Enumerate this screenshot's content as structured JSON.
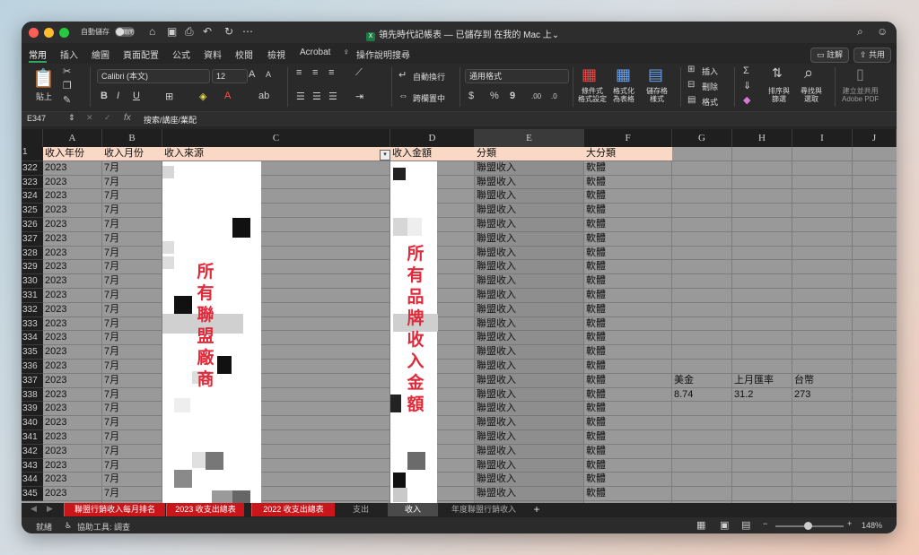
{
  "titlebar": {
    "autosave": "自動儲存",
    "toggle": "關閉",
    "title": "領先時代記帳表 — 已儲存到 在我的 Mac 上",
    "title_arrow": "⌄"
  },
  "menu_tabs": [
    "常用",
    "插入",
    "繪圖",
    "頁面配置",
    "公式",
    "資料",
    "校閱",
    "檢視",
    "Acrobat"
  ],
  "help": "操作說明搜尋",
  "comments_btn": "註解",
  "share_btn": "共用",
  "ribbon": {
    "paste": "貼上",
    "font_name": "Calibri (本文)",
    "font_size": "12",
    "bold": "B",
    "italic": "I",
    "underline": "U",
    "wrap": "自動換行",
    "merge": "跨欄置中",
    "number_format": "通用格式",
    "currency": "$",
    "percent": "%",
    "comma": "9",
    "cond_format": "條件式\n格式設定",
    "format_table": "格式化\n為表格",
    "cell_style": "儲存格\n樣式",
    "insert": "插入",
    "delete": "刪除",
    "format": "格式",
    "sort": "排序與\n篩選",
    "find": "尋找與\n選取",
    "pdf": "建立並共用\nAdobe PDF"
  },
  "formula_bar": {
    "name_box": "E347",
    "fx": "fx",
    "content": "搜索/講座/業配"
  },
  "columns": [
    "A",
    "B",
    "C",
    "D",
    "E",
    "F",
    "G",
    "H",
    "I",
    "J"
  ],
  "header_row": {
    "row": "1",
    "a": "收入年份",
    "b": "收入月份",
    "c": "收入來源",
    "d": "收入金額",
    "e": "分類",
    "f": "大分類"
  },
  "rows": [
    {
      "n": "322",
      "a": "2023",
      "b": "7月",
      "e": "聯盟收入",
      "f": "軟體"
    },
    {
      "n": "323",
      "a": "2023",
      "b": "7月",
      "e": "聯盟收入",
      "f": "軟體"
    },
    {
      "n": "324",
      "a": "2023",
      "b": "7月",
      "e": "聯盟收入",
      "f": "軟體"
    },
    {
      "n": "325",
      "a": "2023",
      "b": "7月",
      "e": "聯盟收入",
      "f": "軟體"
    },
    {
      "n": "326",
      "a": "2023",
      "b": "7月",
      "e": "聯盟收入",
      "f": "軟體"
    },
    {
      "n": "327",
      "a": "2023",
      "b": "7月",
      "e": "聯盟收入",
      "f": "軟體"
    },
    {
      "n": "328",
      "a": "2023",
      "b": "7月",
      "e": "聯盟收入",
      "f": "軟體"
    },
    {
      "n": "329",
      "a": "2023",
      "b": "7月",
      "e": "聯盟收入",
      "f": "軟體"
    },
    {
      "n": "330",
      "a": "2023",
      "b": "7月",
      "e": "聯盟收入",
      "f": "軟體"
    },
    {
      "n": "331",
      "a": "2023",
      "b": "7月",
      "e": "聯盟收入",
      "f": "軟體"
    },
    {
      "n": "332",
      "a": "2023",
      "b": "7月",
      "e": "聯盟收入",
      "f": "軟體"
    },
    {
      "n": "333",
      "a": "2023",
      "b": "7月",
      "e": "聯盟收入",
      "f": "軟體"
    },
    {
      "n": "334",
      "a": "2023",
      "b": "7月",
      "e": "聯盟收入",
      "f": "軟體"
    },
    {
      "n": "335",
      "a": "2023",
      "b": "7月",
      "e": "聯盟收入",
      "f": "軟體"
    },
    {
      "n": "336",
      "a": "2023",
      "b": "7月",
      "e": "聯盟收入",
      "f": "軟體"
    },
    {
      "n": "337",
      "a": "2023",
      "b": "7月",
      "e": "聯盟收入",
      "f": "軟體",
      "g": "美金",
      "h": "上月匯率",
      "i": "台幣"
    },
    {
      "n": "338",
      "a": "2023",
      "b": "7月",
      "e": "聯盟收入",
      "f": "軟體",
      "g": "8.74",
      "h": "31.2",
      "i": "273"
    },
    {
      "n": "339",
      "a": "2023",
      "b": "7月",
      "e": "聯盟收入",
      "f": "軟體"
    },
    {
      "n": "340",
      "a": "2023",
      "b": "7月",
      "e": "聯盟收入",
      "f": "軟體"
    },
    {
      "n": "341",
      "a": "2023",
      "b": "7月",
      "e": "聯盟收入",
      "f": "軟體"
    },
    {
      "n": "342",
      "a": "2023",
      "b": "7月",
      "e": "聯盟收入",
      "f": "軟體"
    },
    {
      "n": "343",
      "a": "2023",
      "b": "7月",
      "e": "聯盟收入",
      "f": "軟體"
    },
    {
      "n": "344",
      "a": "2023",
      "b": "7月",
      "e": "聯盟收入",
      "f": "軟體"
    },
    {
      "n": "345",
      "a": "2023",
      "b": "7月",
      "e": "聯盟收入",
      "f": "軟體"
    }
  ],
  "overlay": {
    "left": [
      "所",
      "有",
      "聯",
      "盟",
      "廠",
      "商"
    ],
    "right": [
      "所",
      "有",
      "品",
      "牌",
      "收",
      "入",
      "金",
      "額"
    ]
  },
  "sheet_tabs": [
    "聯盟行銷收入每月排名",
    "2023 收支出總表",
    "2022 收支出總表",
    "支出",
    "收入",
    "年度聯盟行銷收入"
  ],
  "status": {
    "ready": "就緒",
    "accessibility": "協助工具: 調查",
    "zoom": "148%"
  },
  "colors": {
    "header_fill": "#f9d9c6",
    "selected_tab": "#c8161b",
    "overlay_text": "#e02a3a"
  }
}
